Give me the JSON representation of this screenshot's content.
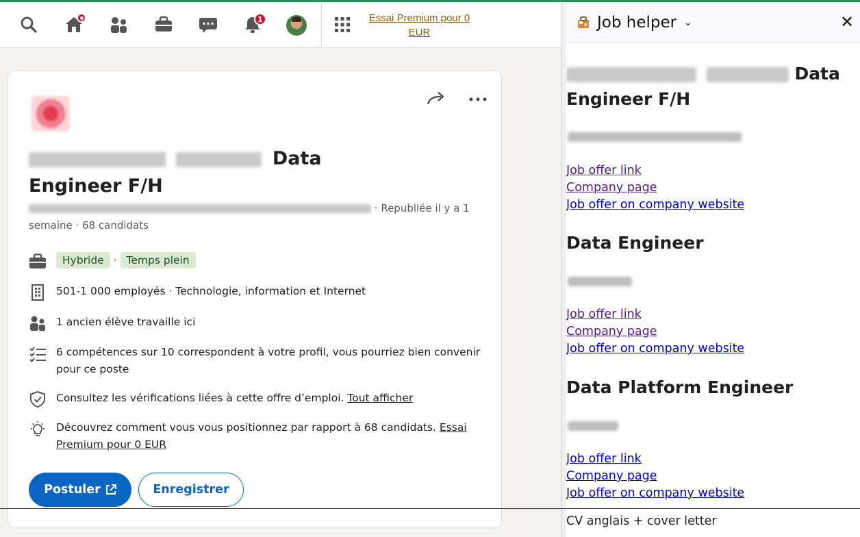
{
  "nav": {
    "premium_label": "Essai Premium pour 0 EUR",
    "home_badge": "",
    "notif_badge": "1",
    "badge_color": "#cb112d"
  },
  "job": {
    "title_suffix": "Data",
    "title_line2": "Engineer F/H",
    "meta_suffix": "· Republiée il y a 1 semaine · 68 candidats",
    "tags": [
      "Hybride",
      "Temps plein"
    ],
    "tag_separator": "·",
    "company_info": "501-1 000 employés · Technologie, information et Internet",
    "alumni": "1 ancien élève travaille ici",
    "skills": "6 compétences sur 10 correspondent à votre profil, vous pourriez bien convenir pour ce poste",
    "verifications_text": "Consultez les vérifications liées à cette offre d’emploi.",
    "verifications_link": "Tout afficher",
    "premium_text": "Découvrez comment vous vous positionnez par rapport à 68 candidats.",
    "premium_link": "Essai Premium pour 0 EUR",
    "apply_label": "Postuler",
    "save_label": "Enregistrer",
    "accent": "#0a66c2"
  },
  "helper": {
    "title": "Job helper",
    "jobs": [
      {
        "title_tail": "Data",
        "title_line2": "Engineer F/H",
        "links": [
          "Job offer link",
          "Company page",
          "Job offer on company website"
        ]
      },
      {
        "title": "Data Engineer",
        "links": [
          "Job offer link",
          "Company page",
          "Job offer on company website"
        ]
      },
      {
        "title": "Data Platform Engineer",
        "links": [
          "Job offer link",
          "Company page",
          "Job offer on company website"
        ]
      }
    ],
    "footer": "CV anglais + cover letter"
  }
}
